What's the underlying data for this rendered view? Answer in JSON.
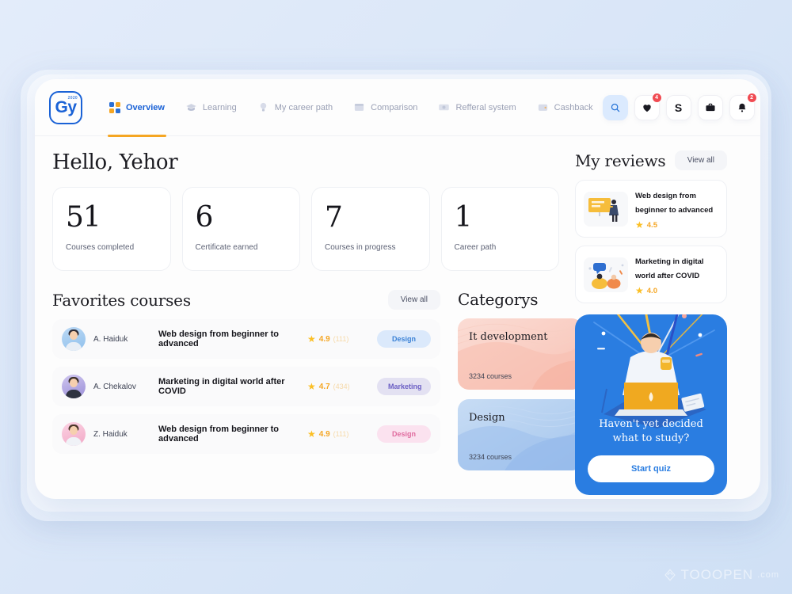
{
  "brand": {
    "logo_text": "Gy",
    "logo_sup": "2020",
    "accent": "#1a62d6",
    "highlight": "#f5a623"
  },
  "nav": {
    "items": [
      {
        "label": "Overview",
        "icon": "grid-icon",
        "active": true
      },
      {
        "label": "Learning",
        "icon": "graduation-cap-icon",
        "active": false
      },
      {
        "label": "My career path",
        "icon": "lightbulb-icon",
        "active": false
      },
      {
        "label": "Comparison",
        "icon": "window-icon",
        "active": false
      },
      {
        "label": "Refferal system",
        "icon": "banknote-icon",
        "active": false
      },
      {
        "label": "Cashback",
        "icon": "wallet-icon",
        "active": false
      }
    ],
    "actions": [
      {
        "name": "search-icon",
        "glyph": "search",
        "badge": ""
      },
      {
        "name": "heart-icon",
        "glyph": "heart",
        "badge": "4"
      },
      {
        "name": "dollar-icon",
        "glyph": "S",
        "badge": ""
      },
      {
        "name": "briefcase-icon",
        "glyph": "briefcase",
        "badge": ""
      },
      {
        "name": "bell-icon",
        "glyph": "bell",
        "badge": "2"
      }
    ]
  },
  "greeting": "Hello, Yehor",
  "stats": [
    {
      "value": "51",
      "label": "Courses completed"
    },
    {
      "value": "6",
      "label": "Certificate earned"
    },
    {
      "value": "7",
      "label": "Courses in progress"
    },
    {
      "value": "1",
      "label": "Career path"
    }
  ],
  "favorites": {
    "title": "Favorites courses",
    "view_all": "View all",
    "courses": [
      {
        "author": "A. Haiduk",
        "title": "Web design from beginner to advanced",
        "rating": "4.9",
        "reviews": "(111)",
        "tag": "Design",
        "tag_style": "design-b"
      },
      {
        "author": "A. Chekalov",
        "title": "Marketing in digital world after COVID",
        "rating": "4.7",
        "reviews": "(434)",
        "tag": "Marketing",
        "tag_style": "marketing"
      },
      {
        "author": "Z. Haiduk",
        "title": "Web design from beginner to advanced",
        "rating": "4.9",
        "reviews": "(111)",
        "tag": "Design",
        "tag_style": "design-p"
      }
    ]
  },
  "categories": {
    "title": "Categorys",
    "cards": [
      {
        "name": "It development",
        "count": "3234 courses",
        "style": "it"
      },
      {
        "name": "Design",
        "count": "3234 courses",
        "style": "de"
      }
    ]
  },
  "reviews": {
    "title": "My reviews",
    "view_all": "View all",
    "items": [
      {
        "title": "Web design from beginner to advanced",
        "rating": "4.5",
        "thumb": "presentation-illustration"
      },
      {
        "title": "Marketing in digital world after COVID",
        "rating": "4.0",
        "thumb": "teamwork-illustration"
      }
    ]
  },
  "promo": {
    "headline": "Haven't yet decided\nwhat to study?",
    "button": "Start quiz"
  },
  "watermark": {
    "main": "TOOOPEN",
    "suffix": ".com"
  }
}
